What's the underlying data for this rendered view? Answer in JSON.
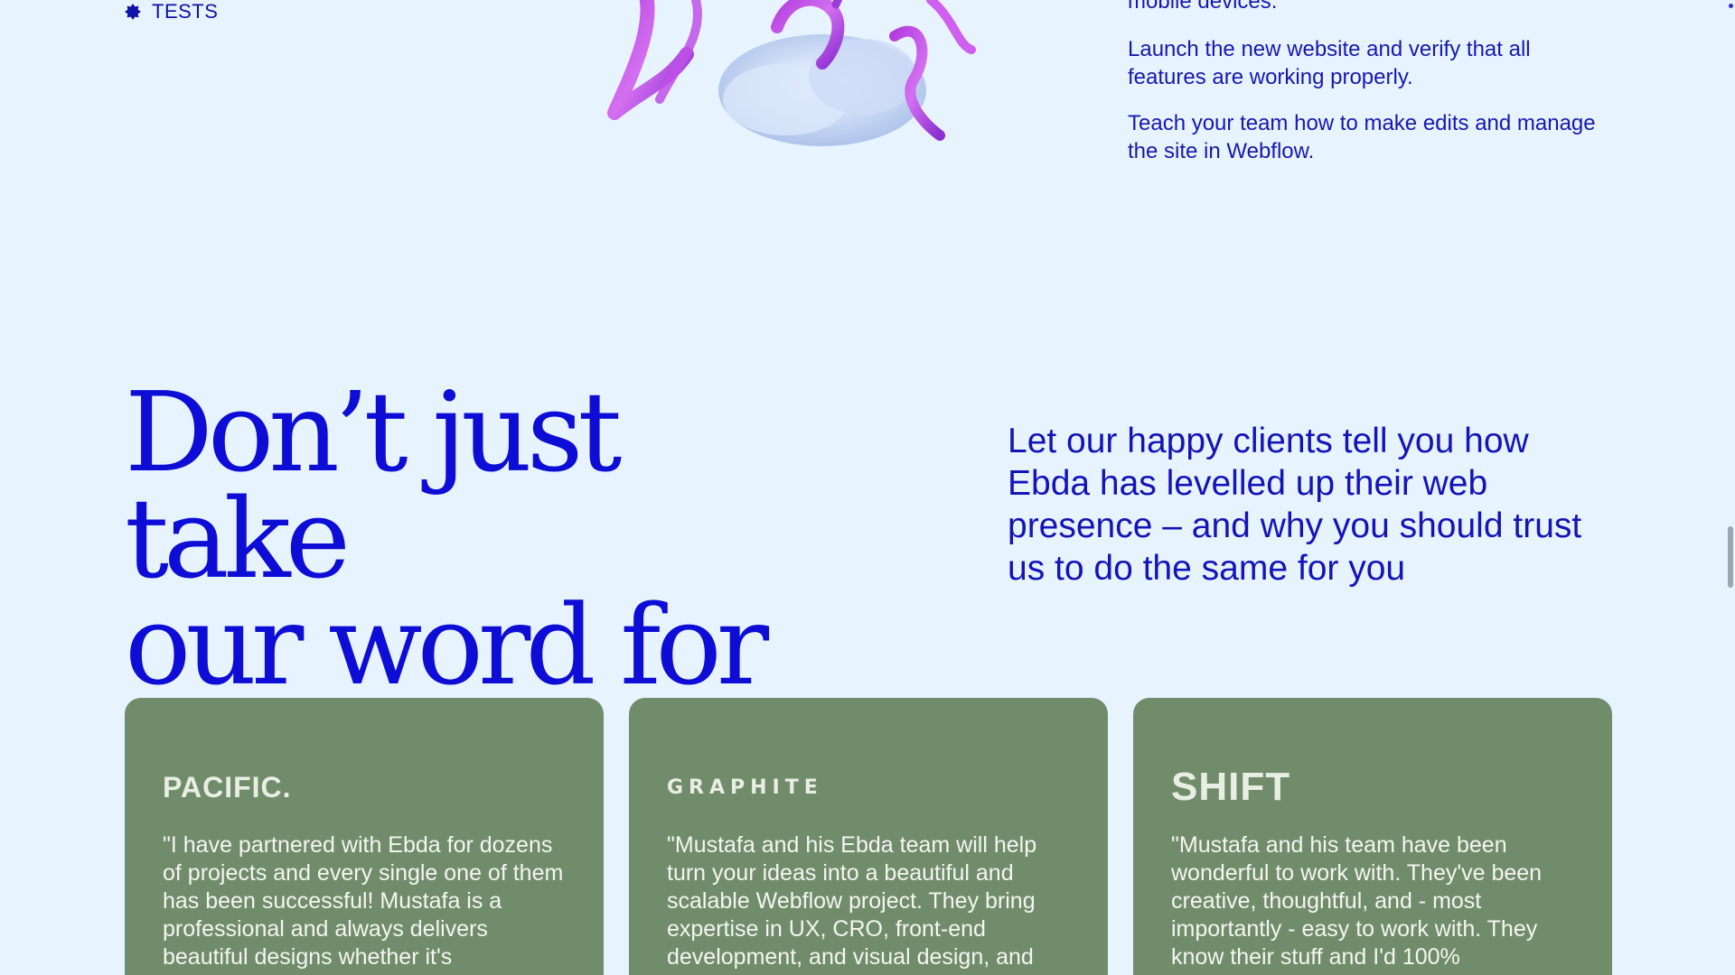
{
  "top": {
    "list_item_label": "TESTS",
    "paragraphs": [
      "mobile devices.",
      "Launch the new website and verify that all features are working properly.",
      "Teach your team how to make edits and manage the site in Webflow."
    ]
  },
  "testimonials_section": {
    "headline_line1": "Don’t just take",
    "headline_line2": "our word for it.",
    "subhead": "Let our happy clients tell you how Ebda has levelled up their web presence – and why you should trust us to do the same for you",
    "cards": [
      {
        "logo": "PACIFIC.",
        "quote": "\"I have partnered with Ebda for dozens of projects and every single one of them has been successful! Mustafa is a professional and always delivers beautiful designs whether it's"
      },
      {
        "logo": "GRAPHITE",
        "quote": "\"Mustafa and his Ebda team will help turn your ideas into a beautiful and scalable Webflow project. They bring expertise in UX, CRO, front-end development, and visual design, and"
      },
      {
        "logo": "SHIFT",
        "quote": "\"Mustafa and his team have been wonderful to work with. They've been creative, thoughtful, and - most importantly - easy to work with. They know their stuff and I'd 100%"
      }
    ]
  },
  "colors": {
    "background": "#e7f3ff",
    "accent_blue": "#0d0dd6",
    "card_green": "#718c6b"
  }
}
